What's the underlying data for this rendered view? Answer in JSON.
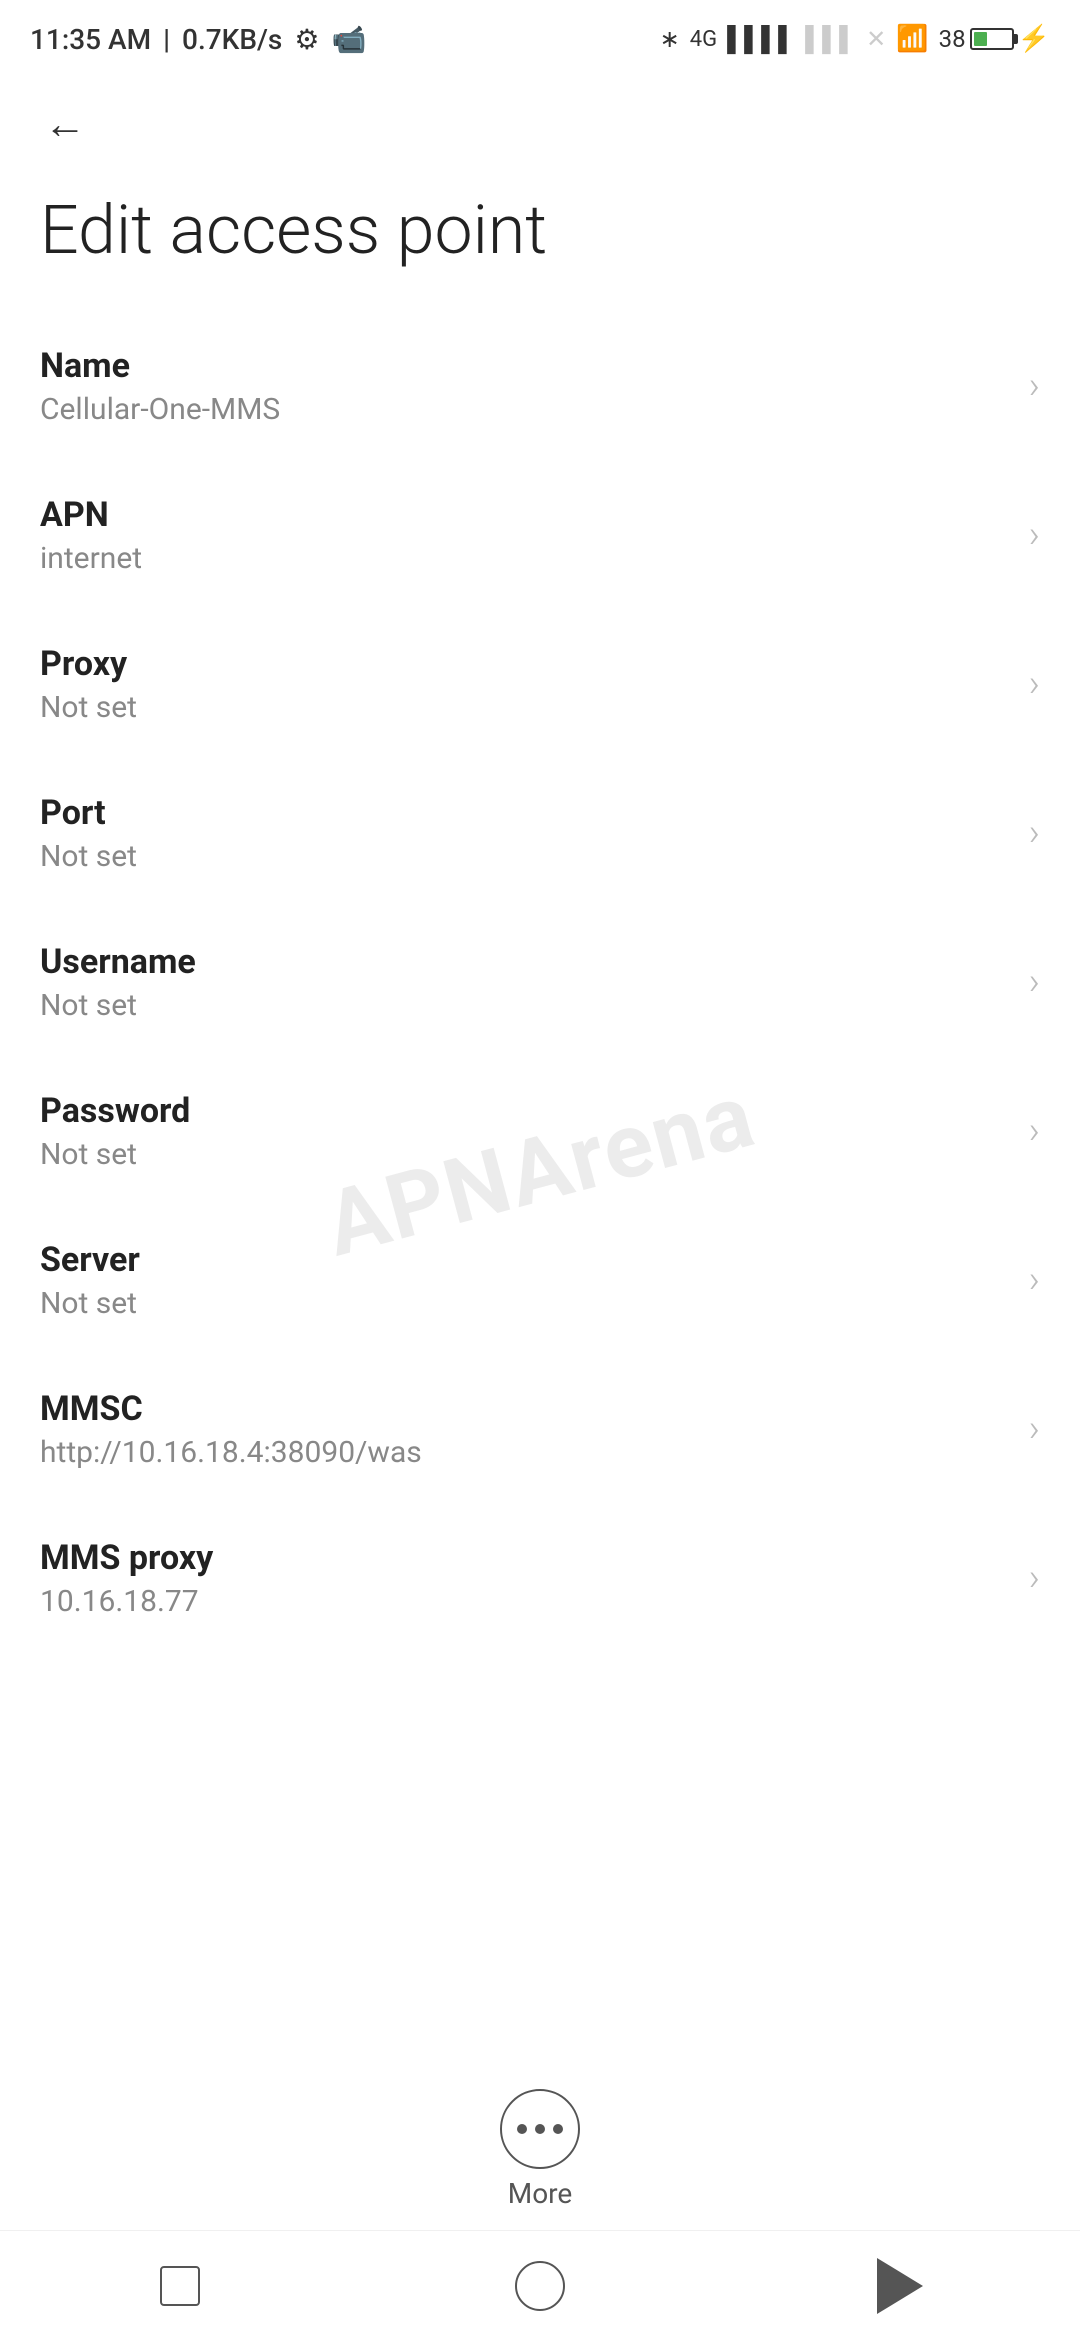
{
  "statusBar": {
    "time": "11:35 AM",
    "speed": "0.7KB/s"
  },
  "nav": {
    "backLabel": "←"
  },
  "page": {
    "title": "Edit access point"
  },
  "settings": [
    {
      "label": "Name",
      "value": "Cellular-One-MMS"
    },
    {
      "label": "APN",
      "value": "internet"
    },
    {
      "label": "Proxy",
      "value": "Not set"
    },
    {
      "label": "Port",
      "value": "Not set"
    },
    {
      "label": "Username",
      "value": "Not set"
    },
    {
      "label": "Password",
      "value": "Not set"
    },
    {
      "label": "Server",
      "value": "Not set"
    },
    {
      "label": "MMSC",
      "value": "http://10.16.18.4:38090/was"
    },
    {
      "label": "MMS proxy",
      "value": "10.16.18.77"
    }
  ],
  "more": {
    "label": "More"
  },
  "watermark": "APNArena"
}
